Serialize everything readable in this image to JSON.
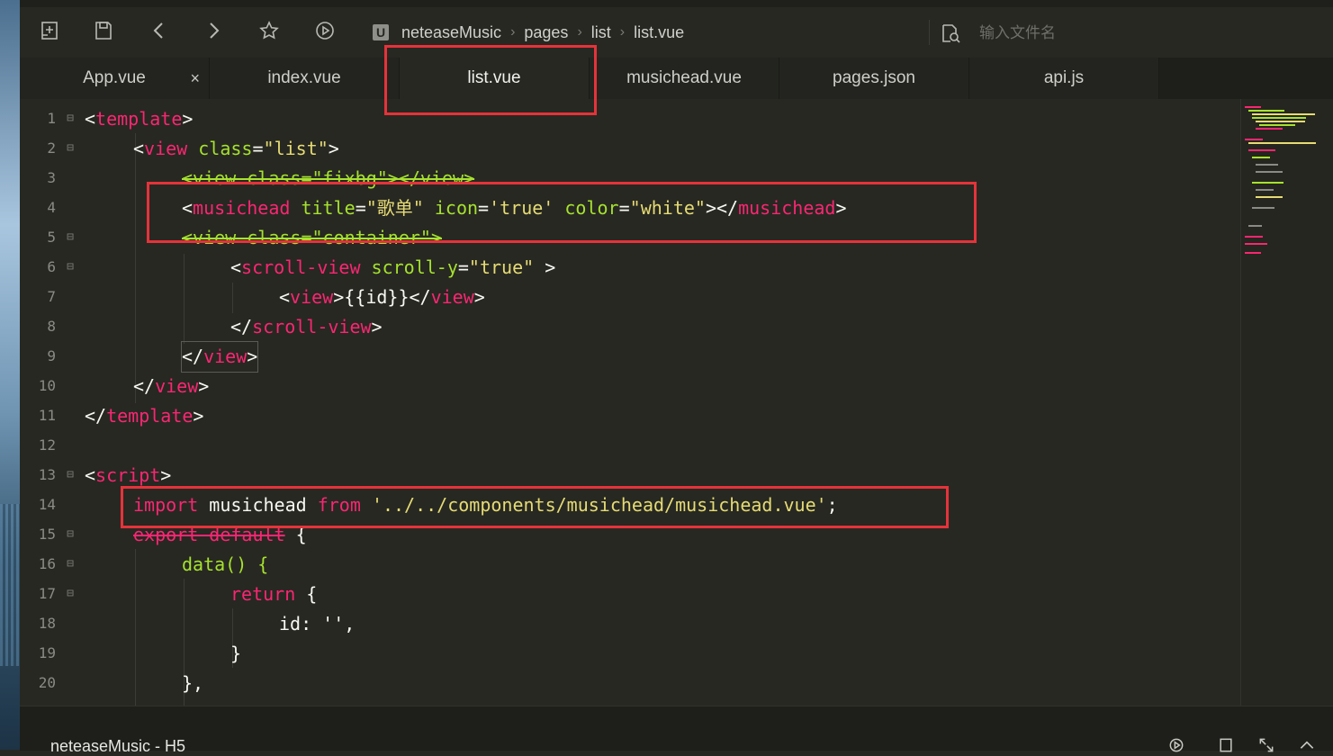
{
  "breadcrumb": {
    "items": [
      "neteaseMusic",
      "pages",
      "list",
      "list.vue"
    ]
  },
  "search": {
    "placeholder": "输入文件名"
  },
  "tabs": [
    {
      "label": "App.vue",
      "close": "×"
    },
    {
      "label": "index.vue"
    },
    {
      "label": "list.vue"
    },
    {
      "label": "musichead.vue"
    },
    {
      "label": "pages.json"
    },
    {
      "label": "api.js"
    }
  ],
  "line_numbers": [
    "1",
    "2",
    "3",
    "4",
    "5",
    "6",
    "7",
    "8",
    "9",
    "10",
    "11",
    "12",
    "13",
    "14",
    "15",
    "16",
    "17",
    "18",
    "19",
    "20"
  ],
  "code": {
    "l1": {
      "open": "<",
      "tag": "template",
      "close": ">"
    },
    "l2": {
      "open": "<",
      "tag": "view",
      "attr": "class",
      "eq": "=",
      "val": "\"list\"",
      "close": ">"
    },
    "l3": {
      "text": "<view class=\"fixbg\"></view>"
    },
    "l4": {
      "open": "<",
      "tag": "musichead",
      "a1": "title",
      "v1": "\"歌单\"",
      "a2": "icon",
      "v2": "'true'",
      "a3": "color",
      "v3": "\"white\"",
      "mid": "></",
      "tag2": "musichead",
      "close": ">"
    },
    "l5": {
      "text": "<view class=\"container\">"
    },
    "l6": {
      "open": "<",
      "tag": "scroll-view",
      "attr": "scroll-y",
      "eq": "=",
      "val": "\"true\"",
      "close": " >"
    },
    "l7": {
      "open": "<",
      "tag": "view",
      "mid": ">{{id}}</",
      "tag2": "view",
      "close": ">"
    },
    "l8": {
      "open": "</",
      "tag": "scroll-view",
      "close": ">"
    },
    "l9": {
      "open": "</",
      "tag": "view",
      "close": ">"
    },
    "l10": {
      "open": "</",
      "tag": "view",
      "close": ">"
    },
    "l11": {
      "open": "</",
      "tag": "template",
      "close": ">"
    },
    "l13": {
      "open": "<",
      "tag": "script",
      "close": ">"
    },
    "l14": {
      "kw1": "import",
      "name": "musichead",
      "kw2": "from",
      "path": "'../../components/musichead/musichead.vue'",
      "end": ";"
    },
    "l15": {
      "kw": "export default",
      "rest": " {"
    },
    "l16": {
      "text": "data() {"
    },
    "l17": {
      "kw": "return",
      "rest": " {"
    },
    "l18": {
      "text": "id: '',"
    },
    "l19": {
      "text": "}"
    },
    "l20": {
      "text": "},"
    }
  },
  "status": {
    "project": "neteaseMusic - H5"
  },
  "colors": {
    "background": "#272822",
    "tag": "#f92672",
    "attribute": "#a6e22e",
    "string": "#e6db74",
    "highlight_box": "#e5333a"
  },
  "icons": [
    "new-file-icon",
    "save-icon",
    "back-icon",
    "forward-icon",
    "star-icon",
    "run-icon",
    "search-file-icon"
  ]
}
